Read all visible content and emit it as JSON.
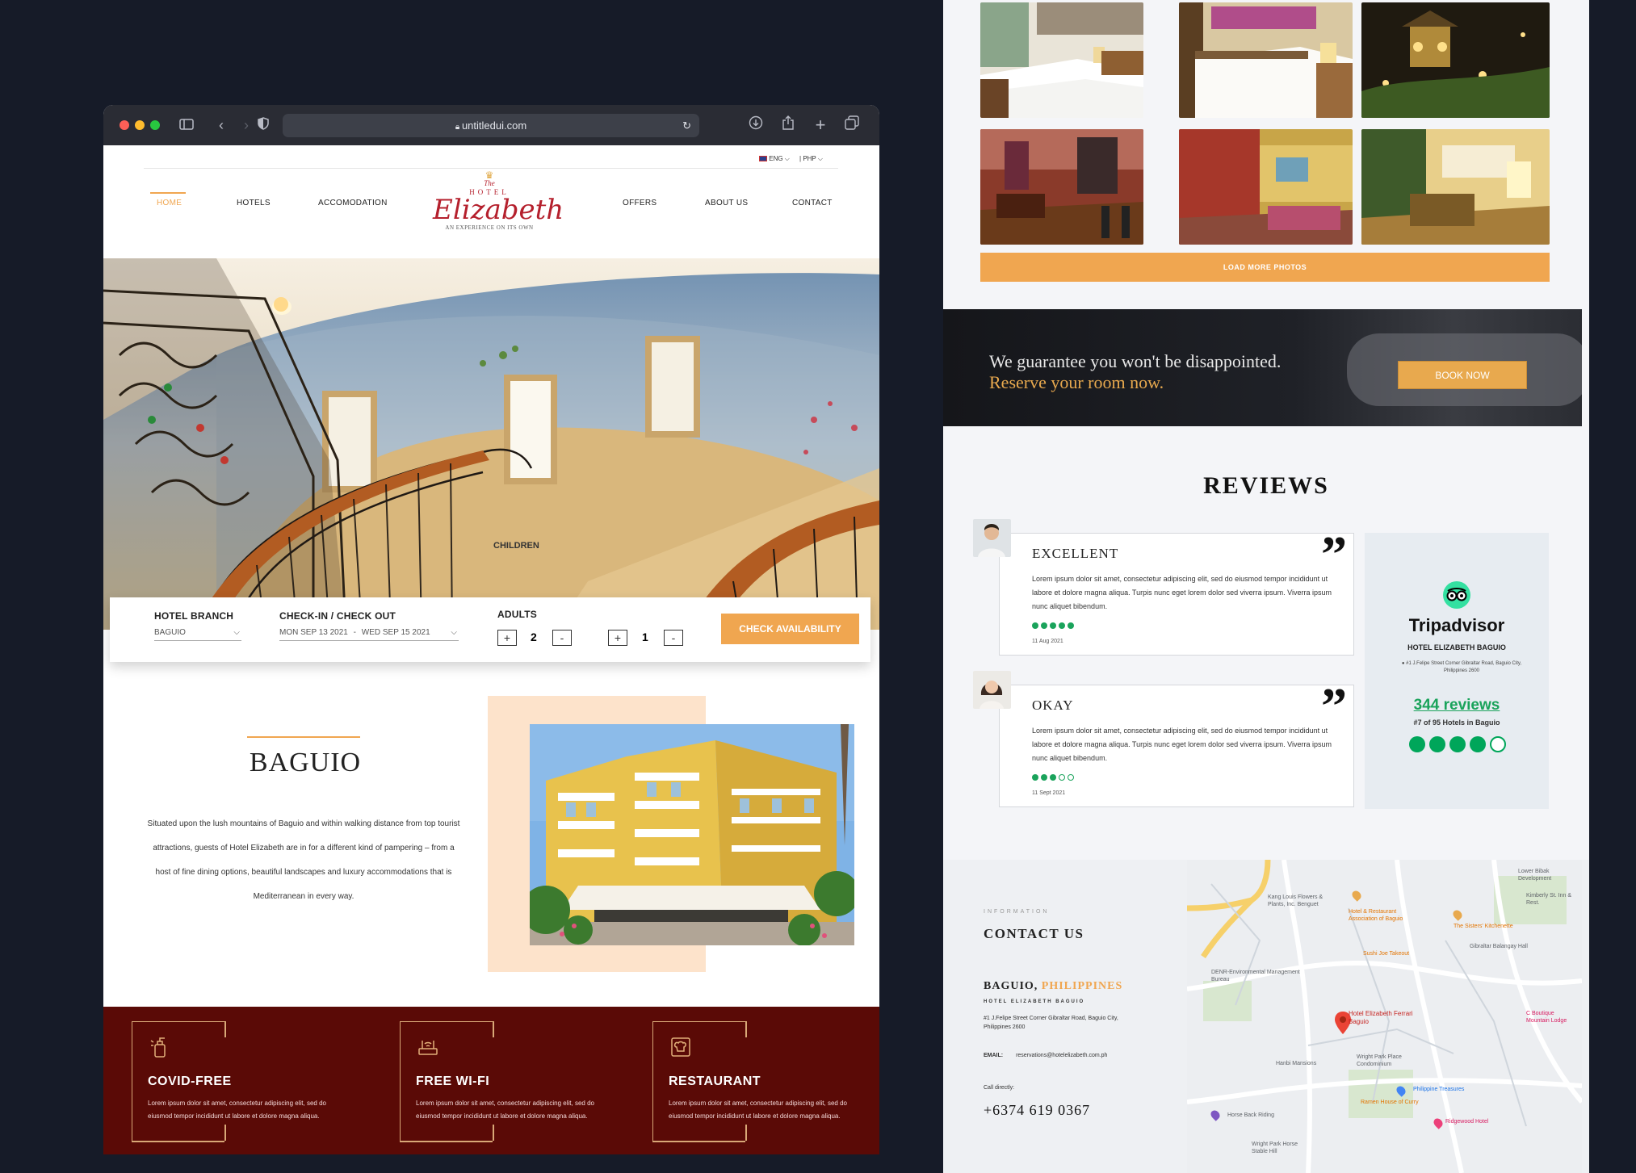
{
  "browser": {
    "url": "untitledui.com"
  },
  "header": {
    "lang": "ENG",
    "currency": "PHP",
    "nav_left": [
      "HOME",
      "HOTELS",
      "ACCOMODATION"
    ],
    "nav_right": [
      "OFFERS",
      "ABOUT US",
      "CONTACT"
    ],
    "logo": {
      "the": "The",
      "hotel": "HOTEL",
      "name": "Elizabeth",
      "tagline": "AN EXPERIENCE ON ITS OWN"
    }
  },
  "hero": {
    "overlay_label": "CHILDREN"
  },
  "booking": {
    "branch_label": "HOTEL BRANCH",
    "branch_value": "BAGUIO",
    "dates_label": "CHECK-IN / CHECK OUT",
    "checkin": "MON SEP 13 2021",
    "separator": "-",
    "checkout": "WED SEP 15 2021",
    "adults_label": "ADULTS",
    "adults_value": "2",
    "children_value": "1",
    "plus": "+",
    "minus": "-",
    "cta": "CHECK AVAILABILITY"
  },
  "about": {
    "title": "BAGUIO",
    "body": "Situated upon the lush mountains of Baguio and within walking distance from top tourist attractions, guests of Hotel Elizabeth are in for a different kind of pampering – from a host of fine dining options, beautiful landscapes and luxury accommodations that is Mediterranean in every way."
  },
  "amenities": [
    {
      "title": "COVID-FREE",
      "text": "Lorem ipsum dolor sit amet, consectetur adipiscing elit, sed do eiusmod tempor incididunt ut labore et dolore magna aliqua.",
      "icon": "sanitizer-icon"
    },
    {
      "title": "FREE WI-FI",
      "text": "Lorem ipsum dolor sit amet, consectetur adipiscing elit, sed do eiusmod tempor incididunt ut labore et dolore magna aliqua.",
      "icon": "wifi-router-icon"
    },
    {
      "title": "RESTAURANT",
      "text": "Lorem ipsum dolor sit amet, consectetur adipiscing elit, sed do eiusmod tempor incididunt ut labore et dolore magna aliqua.",
      "icon": "chef-icon"
    }
  ],
  "gallery": {
    "load_more": "LOAD MORE PHOTOS"
  },
  "cta_banner": {
    "line1": "We guarantee you won't be disappointed.",
    "line2": "Reserve your room now.",
    "button": "BOOK NOW"
  },
  "reviews": {
    "title": "REVIEWS",
    "items": [
      {
        "title": "EXCELLENT",
        "text": "Lorem ipsum dolor sit amet, consectetur adipiscing elit, sed do eiusmod tempor incididunt ut labore et dolore magna aliqua. Turpis nunc eget lorem dolor sed viverra ipsum. Viverra ipsum nunc aliquet bibendum.",
        "rating": 5,
        "date": "11 Aug 2021"
      },
      {
        "title": "OKAY",
        "text": "Lorem ipsum dolor sit amet, consectetur adipiscing elit, sed do eiusmod tempor incididunt ut labore et dolore magna aliqua. Turpis nunc eget lorem dolor sed viverra ipsum. Viverra ipsum nunc aliquet bibendum.",
        "rating": 3,
        "date": "11 Sept 2021"
      }
    ],
    "tripadvisor": {
      "brand": "Tripadvisor",
      "hotel": "HOTEL ELIZABETH BAGUIO",
      "address": "#1 J.Felipe Street Corner Gibraltar Road, Baguio City, Philippines 2600",
      "reviews": "344 reviews",
      "rank": "#7 of 95 Hotels in Baguio",
      "rating": 4
    }
  },
  "contact": {
    "eyebrow": "INFORMATION",
    "title": "CONTACT US",
    "city": "BAGUIO,",
    "country": "PHILIPPINES",
    "hotel_name": "HOTEL ELIZABETH BAGUIO",
    "address": "#1 J.Felipe Street Corner Gibraltar Road, Baguio City, Philippines 2600",
    "email_label": "EMAIL:",
    "email": "reservations@hotelelizabeth.com.ph",
    "call_label": "Call directly:",
    "phone": "+6374 619 0367"
  },
  "map": {
    "labels": [
      "Lower Bibak Development",
      "Kimberly St. Inn & Rest.",
      "Kang Louis Flowers & Plants, Inc. Benguet",
      "Hotel & Restaurant Association of Baguio",
      "The Sisters' Kitchenette",
      "Gibraltar Balangay Hall",
      "Sushi Joe Takeout",
      "DENR-Environmental Management Bureau",
      "Hotel Elizabeth Ferrari Baguio",
      "C Boutique Mountain Lodge",
      "Hanbi Mansions",
      "Wright Park Place Condominium",
      "Philippine Treasures",
      "Ramen House of Curry",
      "Ridgewood Hotel",
      "Horse Back Riding",
      "Wright Park Horse Stable Hill"
    ],
    "accent": "#e8a94e"
  },
  "colors": {
    "accent": "#f0a650",
    "maroon": "#5a0a06",
    "tripadvisor_green": "#1aa35b",
    "logo_red": "#b5202d"
  }
}
